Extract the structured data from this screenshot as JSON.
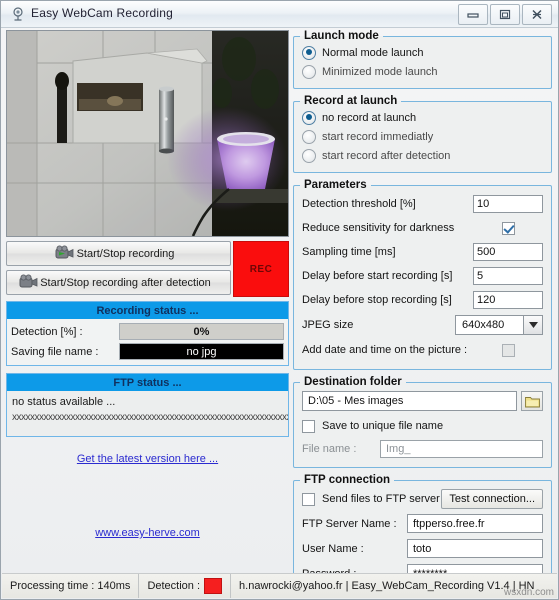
{
  "window": {
    "title": "Easy WebCam Recording",
    "icon": "webcam-icon",
    "controls": {
      "minimize": "minimize-icon",
      "maximize": "maximize-icon",
      "close": "close-icon"
    }
  },
  "camera": {
    "label": "webcam-live-preview"
  },
  "buttons": {
    "start_stop": "Start/Stop recording",
    "start_stop_detection": "Start/Stop recording after detection",
    "rec": "REC"
  },
  "recording_status": {
    "header": "Recording status ...",
    "detection_label": "Detection [%] :",
    "detection_value": "0%",
    "saving_label": "Saving file name :",
    "saving_value": "no jpg"
  },
  "ftp_status": {
    "header": "FTP status ...",
    "line1": "no status available ...",
    "line2": "xxxxxxxxxxxxxxxxxxxxxxxxxxxxxxxxxxxxxxxxxxxxxxxxxxxxxxxxxxxxxxxxxxxxxxxx"
  },
  "links": {
    "latest_version": "Get the latest version here ...",
    "website": "www.easy-herve.com"
  },
  "launch_mode": {
    "legend": "Launch mode",
    "options": [
      {
        "label": "Normal mode launch",
        "selected": true
      },
      {
        "label": "Minimized mode launch",
        "selected": false
      }
    ]
  },
  "record_at_launch": {
    "legend": "Record at launch",
    "options": [
      {
        "label": "no record at launch",
        "selected": true
      },
      {
        "label": "start record immediatly",
        "selected": false
      },
      {
        "label": "start record after detection",
        "selected": false
      }
    ]
  },
  "parameters": {
    "legend": "Parameters",
    "detection_threshold_label": "Detection threshold [%]",
    "detection_threshold_value": "10",
    "reduce_sensitivity_label": "Reduce sensitivity for darkness",
    "reduce_sensitivity_checked": true,
    "sampling_time_label": "Sampling time [ms]",
    "sampling_time_value": "500",
    "delay_start_label": "Delay before start recording [s]",
    "delay_start_value": "5",
    "delay_stop_label": "Delay before stop recording [s]",
    "delay_stop_value": "120",
    "jpeg_size_label": "JPEG size",
    "jpeg_size_value": "640x480",
    "add_datetime_label": "Add date and time on the picture :",
    "add_datetime_checked": false
  },
  "destination_folder": {
    "legend": "Destination folder",
    "path": "D:\\05 - Mes images",
    "browse_icon": "folder-icon",
    "unique_name_label": "Save to unique file name",
    "unique_name_checked": false,
    "file_name_label": "File name :",
    "file_name_value": "Img_"
  },
  "ftp_connection": {
    "legend": "FTP connection",
    "send_files_label": "Send files to FTP server",
    "send_files_checked": false,
    "test_button": "Test connection...",
    "server_label": "FTP Server Name :",
    "server_value": "ftpperso.free.fr",
    "user_label": "User Name :",
    "user_value": "toto",
    "password_label": "Password :",
    "password_value": "********"
  },
  "statusbar": {
    "processing": "Processing time : 140ms",
    "detection_label": "Detection :",
    "detection_color": "#f51f1f",
    "info": "h.nawrocki@yahoo.fr  |  Easy_WebCam_Recording V1.4 | HN",
    "watermark": "wsxdn.com"
  }
}
